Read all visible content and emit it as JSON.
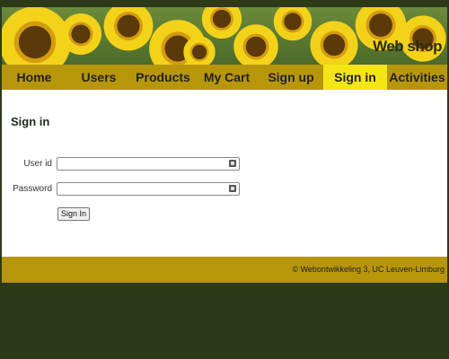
{
  "header": {
    "title": "Web shop"
  },
  "nav": {
    "items": [
      {
        "label": "Home",
        "active": false
      },
      {
        "label": "Users",
        "active": false
      },
      {
        "label": "Products",
        "active": false
      },
      {
        "label": "My Cart",
        "active": false
      },
      {
        "label": "Sign up",
        "active": false
      },
      {
        "label": "Sign in",
        "active": true
      },
      {
        "label": "Activities",
        "active": false
      }
    ]
  },
  "main": {
    "heading": "Sign in",
    "form": {
      "userid_label": "User id",
      "userid_value": "",
      "password_label": "Password",
      "password_value": "",
      "submit_label": "Sign In"
    }
  },
  "footer": {
    "text": "© Webontwikkeling 3, UC Leuven-Limburg"
  },
  "colors": {
    "nav_bg": "#b8960a",
    "nav_active": "#f4e616",
    "page_bg": "#2c3a1a",
    "content_bg": "#ffffff"
  }
}
